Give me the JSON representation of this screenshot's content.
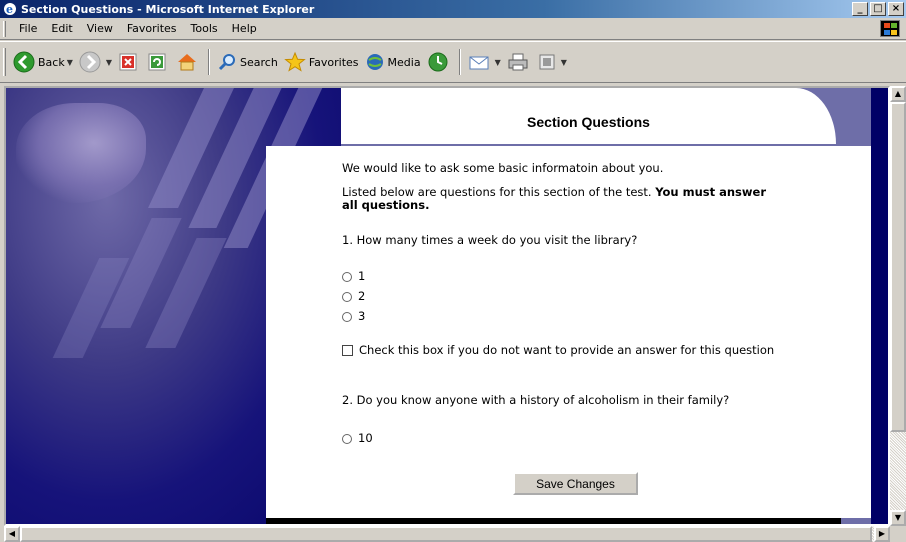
{
  "window": {
    "title": "Section Questions - Microsoft Internet Explorer",
    "controls": {
      "minimize": "_",
      "maximize": "□",
      "close": "×"
    }
  },
  "menu": [
    {
      "label": "File"
    },
    {
      "label": "Edit"
    },
    {
      "label": "View"
    },
    {
      "label": "Favorites"
    },
    {
      "label": "Tools"
    },
    {
      "label": "Help"
    }
  ],
  "toolbar": {
    "back": "Back",
    "search": "Search",
    "favorites": "Favorites",
    "media": "Media"
  },
  "page": {
    "title": "Section Questions",
    "intro": "We would like to ask some basic informatoin about you.",
    "instructions_prefix": "Listed below are questions for this section of the test.",
    "instructions_bold": "You must answer all questions.",
    "q1": {
      "text": "1. How many times a week do you visit the library?",
      "options": [
        "1",
        "2",
        "3"
      ]
    },
    "optout_label": "Check this box if you do not want to provide an answer for this question",
    "q2": {
      "text": "2. Do you know anyone with a history of alcoholism in their family?",
      "options": [
        "10"
      ]
    },
    "save_label": "Save Changes"
  },
  "colors": {
    "title_bar": "#0a246a",
    "chrome": "#d4d0c8",
    "page_background": "#000066",
    "side_band": "#6e6ea8"
  }
}
